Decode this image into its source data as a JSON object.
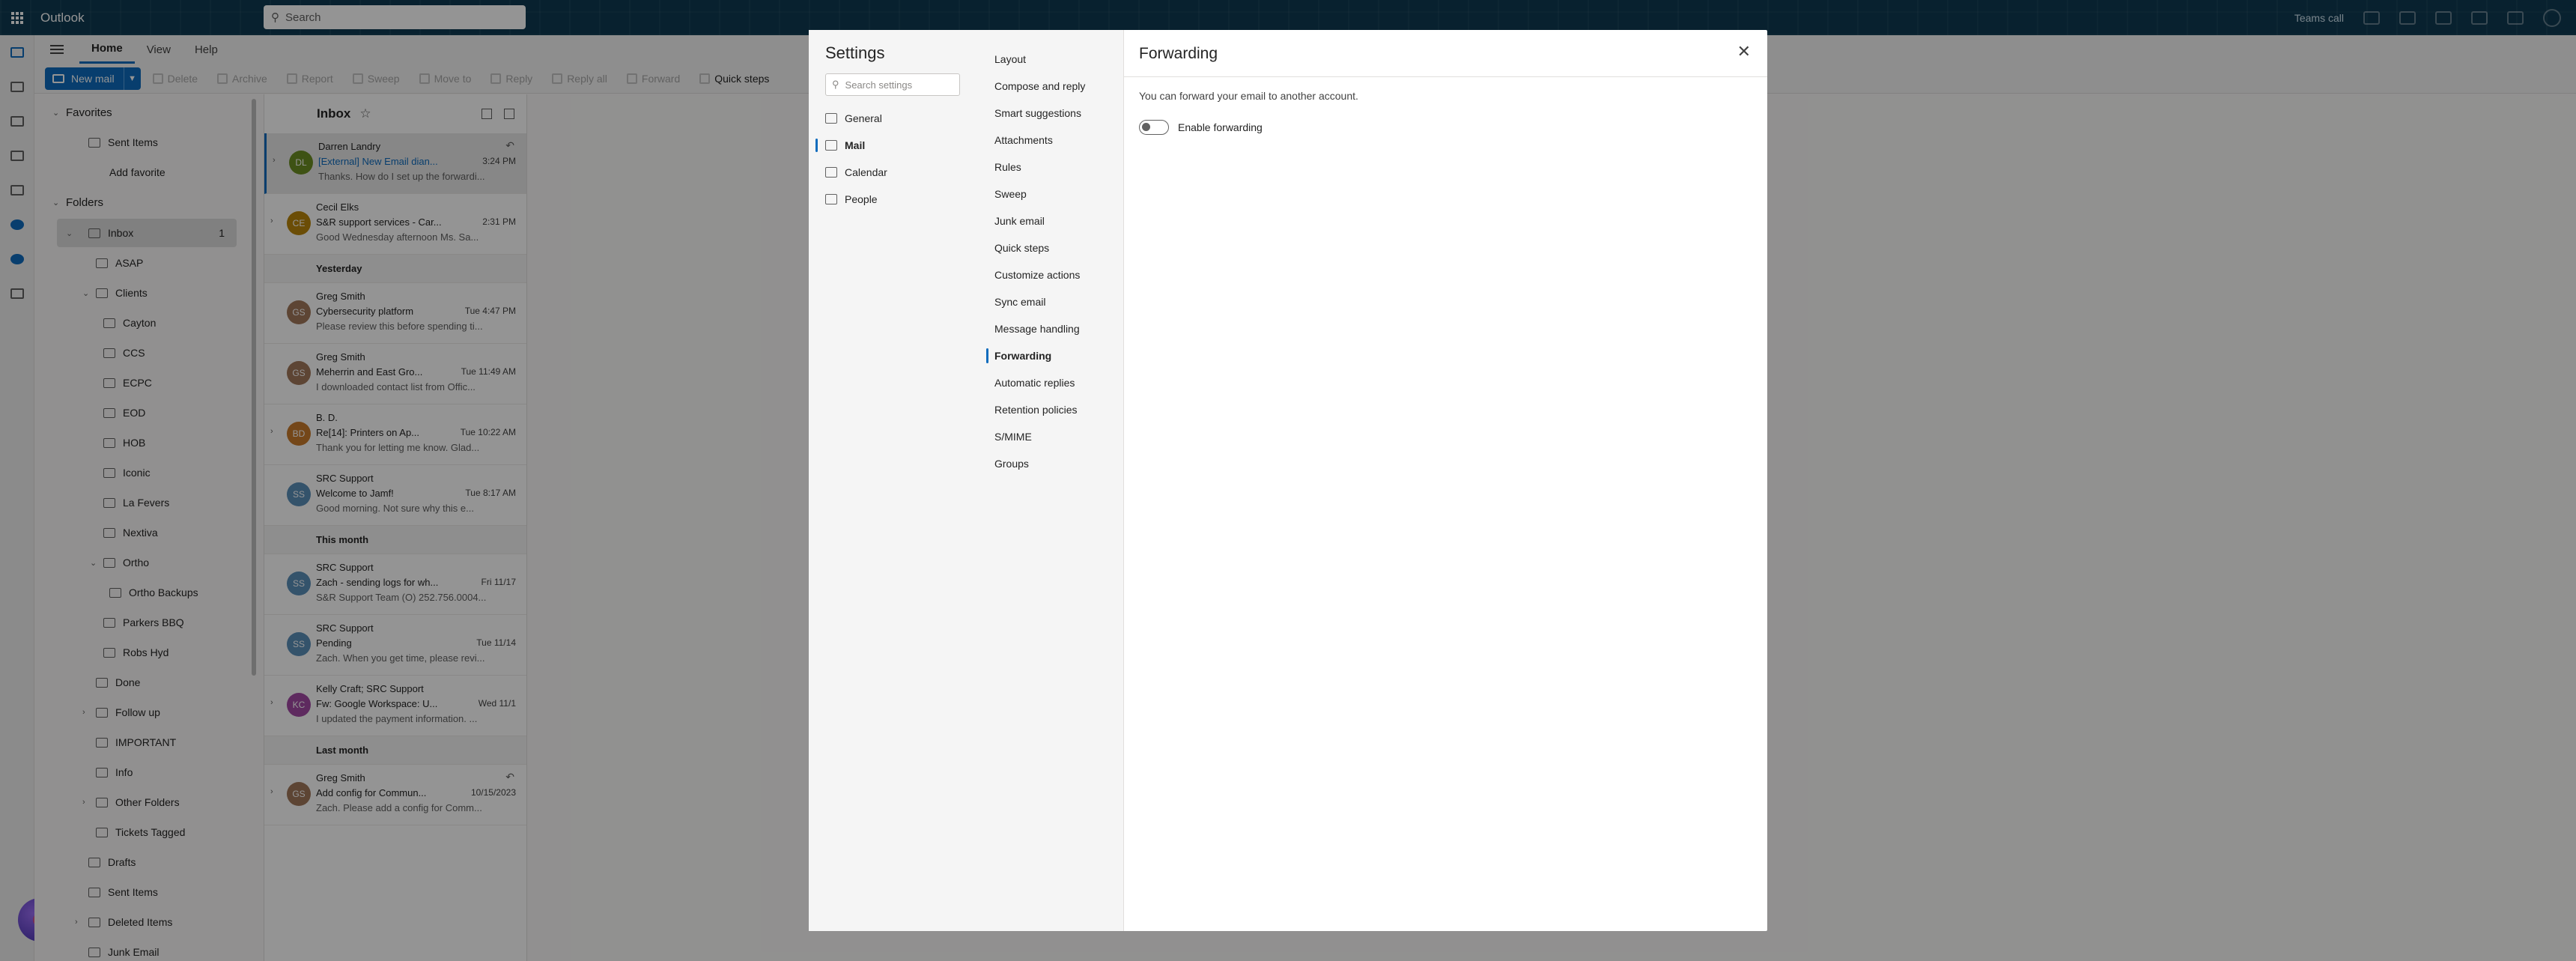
{
  "app": {
    "name": "Outlook",
    "search_placeholder": "Search",
    "right_label": "Teams call"
  },
  "tabs": [
    {
      "label": "Home"
    },
    {
      "label": "View"
    },
    {
      "label": "Help"
    }
  ],
  "ribbon": {
    "new_mail": "New mail",
    "buttons": [
      {
        "label": "Delete"
      },
      {
        "label": "Archive"
      },
      {
        "label": "Report"
      },
      {
        "label": "Sweep"
      },
      {
        "label": "Move to"
      },
      {
        "label": "Reply"
      },
      {
        "label": "Reply all"
      },
      {
        "label": "Forward"
      },
      {
        "label": "Quick steps"
      }
    ]
  },
  "folders": {
    "favorites_label": "Favorites",
    "favorites": [
      {
        "label": "Sent Items"
      },
      {
        "label": "Add favorite"
      }
    ],
    "folders_label": "Folders",
    "inbox": {
      "label": "Inbox",
      "count": "1"
    },
    "items": [
      {
        "label": "ASAP"
      },
      {
        "label": "Clients"
      },
      {
        "label": "Cayton"
      },
      {
        "label": "CCS"
      },
      {
        "label": "ECPC"
      },
      {
        "label": "EOD"
      },
      {
        "label": "HOB"
      },
      {
        "label": "Iconic"
      },
      {
        "label": "La Fevers"
      },
      {
        "label": "Nextiva"
      },
      {
        "label": "Ortho"
      },
      {
        "label": "Ortho Backups"
      },
      {
        "label": "Parkers BBQ"
      },
      {
        "label": "Robs Hyd"
      },
      {
        "label": "Done"
      },
      {
        "label": "Follow up"
      },
      {
        "label": "IMPORTANT"
      },
      {
        "label": "Info"
      },
      {
        "label": "Other Folders"
      },
      {
        "label": "Tickets Tagged"
      },
      {
        "label": "Drafts"
      },
      {
        "label": "Sent Items"
      },
      {
        "label": "Deleted Items"
      },
      {
        "label": "Junk Email"
      }
    ]
  },
  "message_list": {
    "title": "Inbox",
    "groups": {
      "yesterday": "Yesterday",
      "this_month": "This month",
      "last_month": "Last month"
    },
    "messages": [
      {
        "initials": "DL",
        "color": "#6b8e23",
        "from": "Darren Landry",
        "subject": "[External] New Email dian...",
        "time": "3:24 PM",
        "preview": "Thanks. How do I set up the forwardi..."
      },
      {
        "initials": "CE",
        "color": "#b8860b",
        "from": "Cecil Elks",
        "subject": "S&R support services - Car...",
        "time": "2:31 PM",
        "preview": "Good Wednesday afternoon Ms. Sa..."
      },
      {
        "initials": "GS",
        "color": "#a0775a",
        "from": "Greg Smith",
        "subject": "Cybersecurity platform",
        "time": "Tue 4:47 PM",
        "preview": "Please review this before spending ti..."
      },
      {
        "initials": "GS",
        "color": "#a0775a",
        "from": "Greg Smith",
        "subject": "Meherrin and East Gro...",
        "time": "Tue 11:49 AM",
        "preview": "I downloaded contact list from Offic..."
      },
      {
        "initials": "BD",
        "color": "#c97a2b",
        "from": "B. D.",
        "subject": "Re[14]: Printers on Ap...",
        "time": "Tue 10:22 AM",
        "preview": "Thank you for letting me know. Glad..."
      },
      {
        "initials": "SS",
        "color": "#5b8fb9",
        "from": "SRC Support",
        "subject": "Welcome to Jamf!",
        "time": "Tue 8:17 AM",
        "preview": "Good morning. Not sure why this e..."
      },
      {
        "initials": "SS",
        "color": "#5b8fb9",
        "from": "SRC Support",
        "subject": "Zach - sending logs for wh...",
        "time": "Fri 11/17",
        "preview": "S&R Support Team (O) 252.756.0004..."
      },
      {
        "initials": "SS",
        "color": "#5b8fb9",
        "from": "SRC Support",
        "subject": "Pending",
        "time": "Tue 11/14",
        "preview": "Zach. When you get time, please revi..."
      },
      {
        "initials": "KC",
        "color": "#a349a4",
        "from": "Kelly Craft; SRC Support",
        "subject": "Fw: Google Workspace: U...",
        "time": "Wed 11/1",
        "preview": "I updated the payment information. ..."
      },
      {
        "initials": "GS",
        "color": "#a0775a",
        "from": "Greg Smith",
        "subject": "Add config for Commun...",
        "time": "10/15/2023",
        "preview": "Zach. Please add a config for Comm..."
      }
    ]
  },
  "settings": {
    "title": "Settings",
    "search_placeholder": "Search settings",
    "categories": [
      {
        "label": "General"
      },
      {
        "label": "Mail"
      },
      {
        "label": "Calendar"
      },
      {
        "label": "People"
      }
    ],
    "subs": [
      {
        "label": "Layout"
      },
      {
        "label": "Compose and reply"
      },
      {
        "label": "Smart suggestions"
      },
      {
        "label": "Attachments"
      },
      {
        "label": "Rules"
      },
      {
        "label": "Sweep"
      },
      {
        "label": "Junk email"
      },
      {
        "label": "Quick steps"
      },
      {
        "label": "Customize actions"
      },
      {
        "label": "Sync email"
      },
      {
        "label": "Message handling"
      },
      {
        "label": "Forwarding"
      },
      {
        "label": "Automatic replies"
      },
      {
        "label": "Retention policies"
      },
      {
        "label": "S/MIME"
      },
      {
        "label": "Groups"
      }
    ],
    "pane": {
      "title": "Forwarding",
      "description": "You can forward your email to another account.",
      "toggle_label": "Enable forwarding",
      "toggle_on": false
    }
  }
}
